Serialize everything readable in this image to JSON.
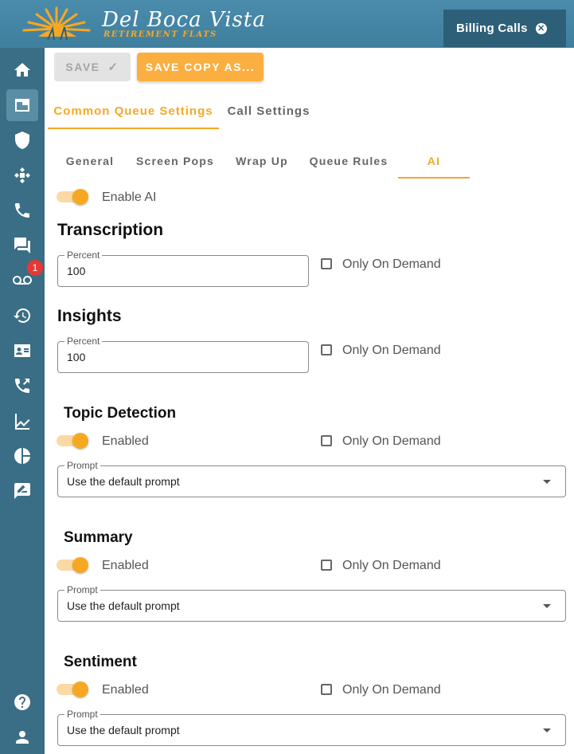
{
  "brand": {
    "title": "Del Boca Vista",
    "subtitle": "RETIREMENT FLATS"
  },
  "open_tab": {
    "label": "Billing Calls",
    "close_icon": "close-circle-icon"
  },
  "sidebar": {
    "items": [
      {
        "name": "home",
        "icon": "home-icon"
      },
      {
        "name": "queues",
        "icon": "window-icon",
        "active": true
      },
      {
        "name": "security",
        "icon": "shield-icon"
      },
      {
        "name": "routing",
        "icon": "routing-icon"
      },
      {
        "name": "calls",
        "icon": "phone-icon"
      },
      {
        "name": "chat",
        "icon": "chat-icon"
      },
      {
        "name": "voicemail",
        "icon": "voicemail-icon",
        "badge": "1"
      },
      {
        "name": "history",
        "icon": "history-icon"
      },
      {
        "name": "contacts",
        "icon": "contact-card-icon"
      },
      {
        "name": "transfer",
        "icon": "call-transfer-icon"
      },
      {
        "name": "reports",
        "icon": "trend-chart-icon"
      },
      {
        "name": "analytics",
        "icon": "pie-chart-icon"
      },
      {
        "name": "feedback",
        "icon": "feedback-icon"
      },
      {
        "name": "help",
        "icon": "help-icon"
      },
      {
        "name": "profile",
        "icon": "person-icon"
      }
    ]
  },
  "toolbar": {
    "save_label": "SAVE",
    "save_copy_label": "SAVE COPY AS..."
  },
  "main_tabs": [
    {
      "label": "Common Queue Settings",
      "active": true
    },
    {
      "label": "Call Settings"
    }
  ],
  "sub_tabs": [
    {
      "label": "General"
    },
    {
      "label": "Screen Pops"
    },
    {
      "label": "Wrap Up"
    },
    {
      "label": "Queue Rules"
    },
    {
      "label": "AI",
      "active": true
    }
  ],
  "ai": {
    "enable_label": "Enable AI",
    "enable_on": true,
    "transcription": {
      "title": "Transcription",
      "field_label": "Percent",
      "value": "100",
      "on_demand_label": "Only On Demand",
      "on_demand": false
    },
    "insights": {
      "title": "Insights",
      "field_label": "Percent",
      "value": "100",
      "on_demand_label": "Only On Demand",
      "on_demand": false
    },
    "topic_detection": {
      "title": "Topic Detection",
      "enabled_label": "Enabled",
      "enabled": true,
      "on_demand_label": "Only On Demand",
      "on_demand": false,
      "prompt_label": "Prompt",
      "prompt_value": "Use the default prompt"
    },
    "summary": {
      "title": "Summary",
      "enabled_label": "Enabled",
      "enabled": true,
      "on_demand_label": "Only On Demand",
      "on_demand": false,
      "prompt_label": "Prompt",
      "prompt_value": "Use the default prompt"
    },
    "sentiment": {
      "title": "Sentiment",
      "enabled_label": "Enabled",
      "enabled": true,
      "on_demand_label": "Only On Demand",
      "on_demand": false,
      "prompt_label": "Prompt",
      "prompt_value": "Use the default prompt"
    }
  },
  "colors": {
    "header": "#4b8bab",
    "sidebar": "#3a6e86",
    "accent": "#f7a823",
    "badge": "#e53935"
  }
}
